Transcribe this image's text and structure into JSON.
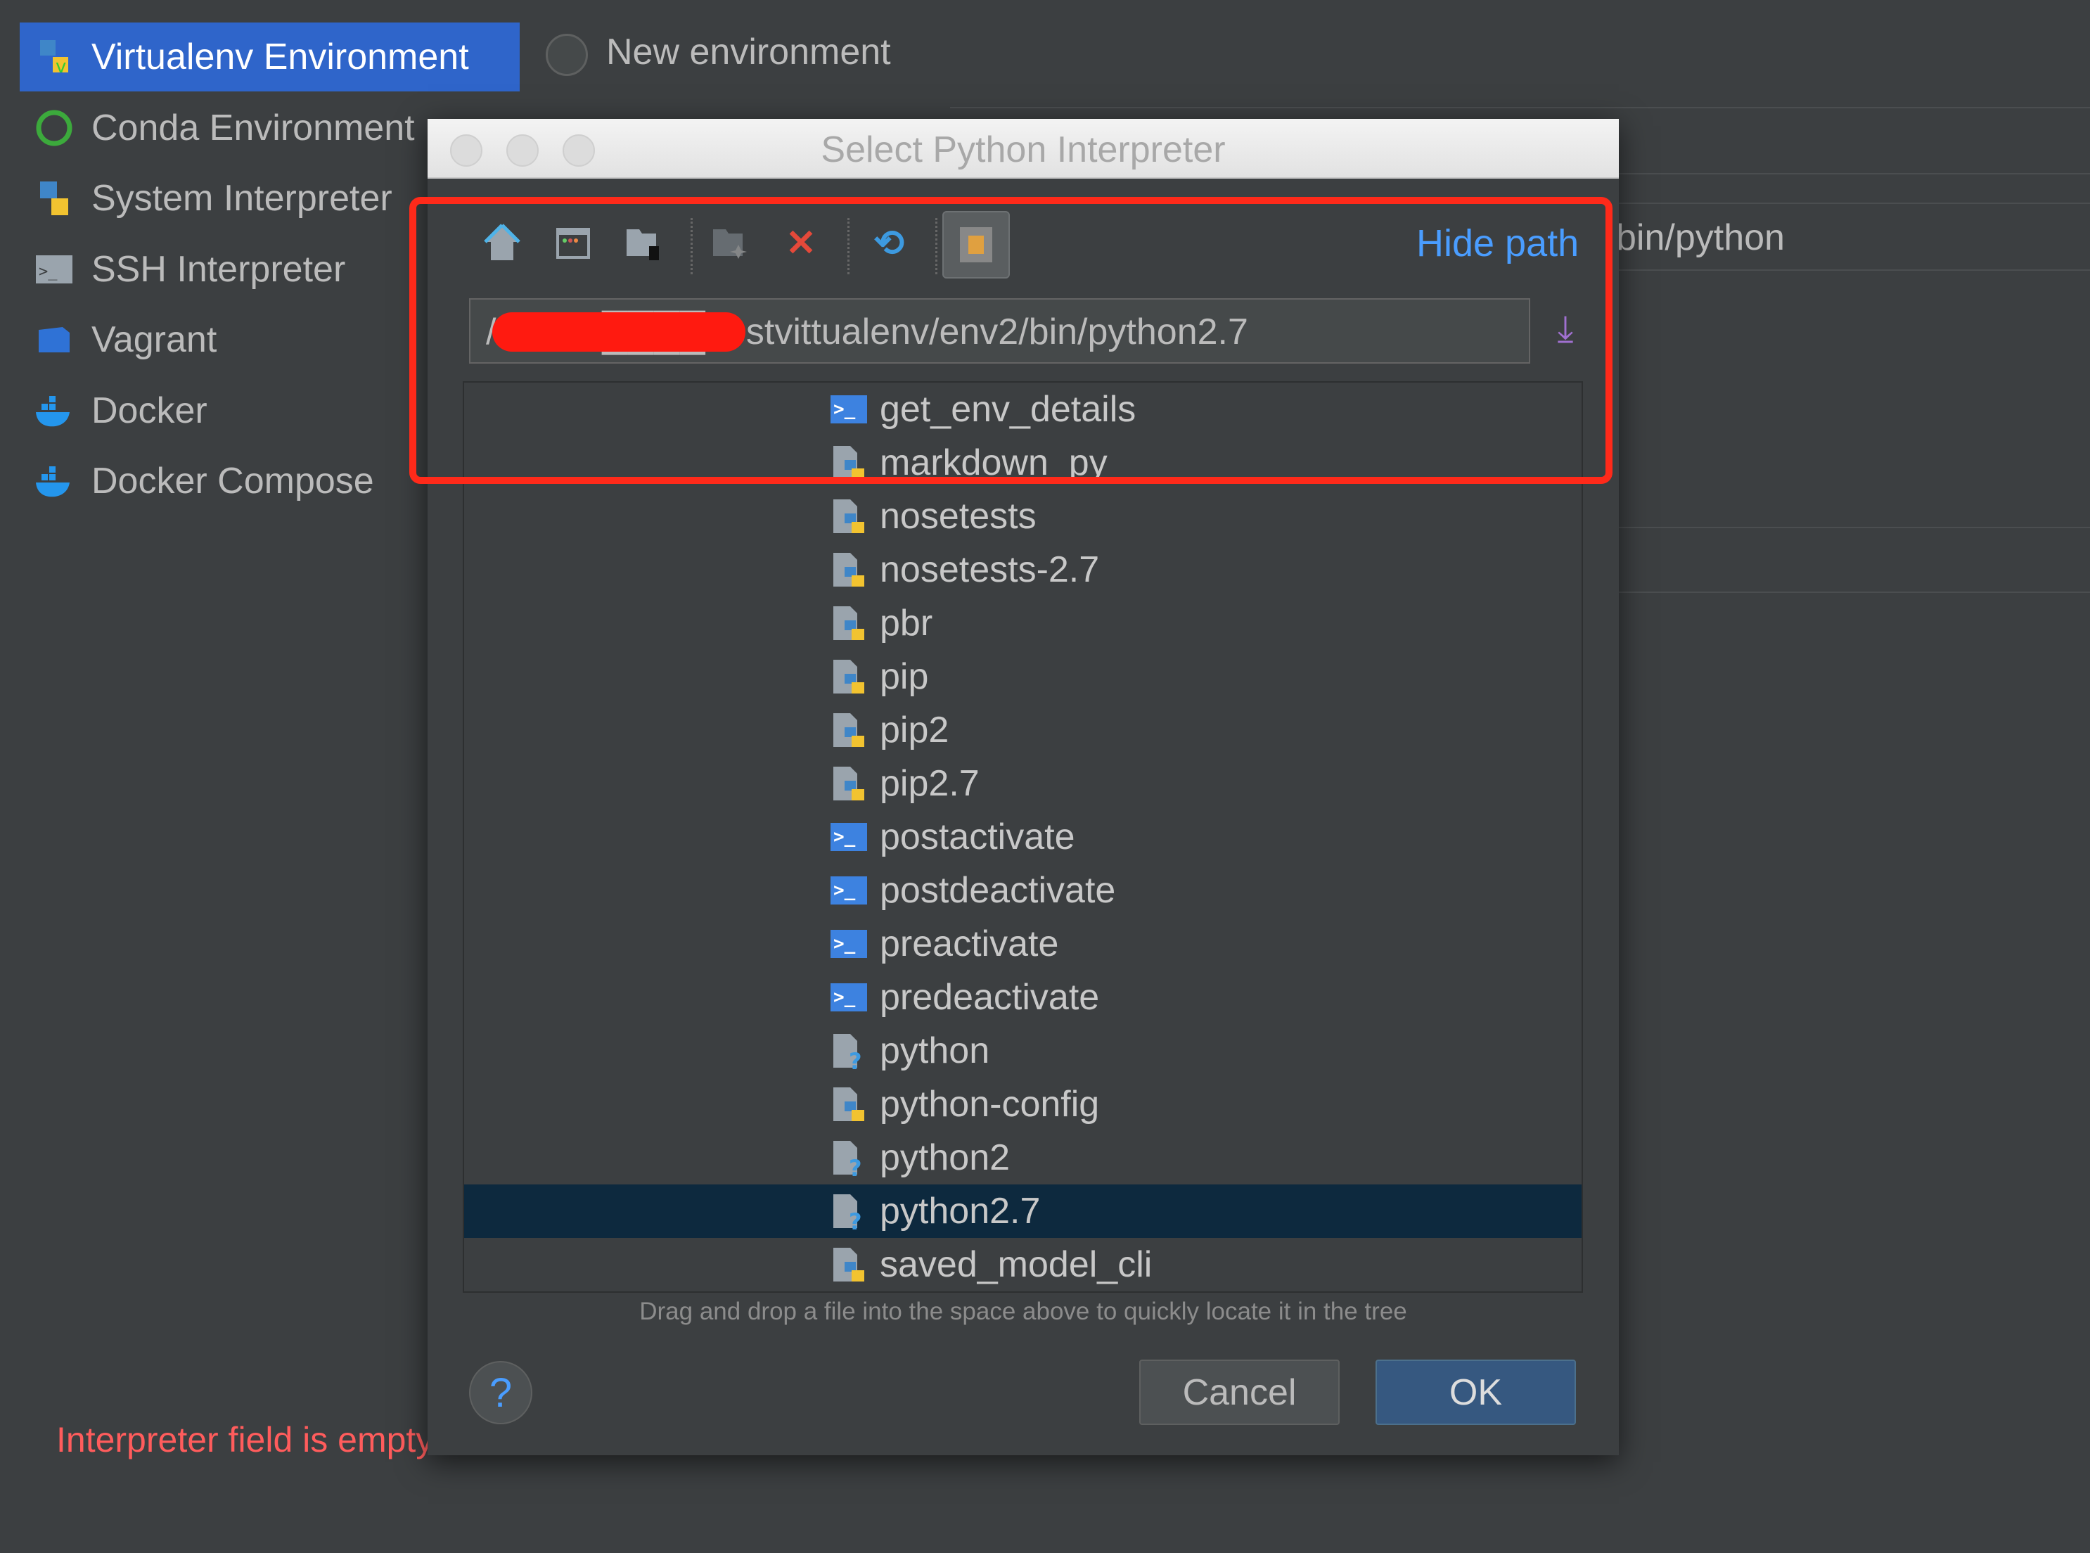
{
  "sidebar": {
    "items": [
      {
        "label": "Virtualenv Environment",
        "icon": "python-virtualenv-icon",
        "selected": true
      },
      {
        "label": "Conda Environment",
        "icon": "conda-icon"
      },
      {
        "label": "System Interpreter",
        "icon": "python-icon"
      },
      {
        "label": "SSH Interpreter",
        "icon": "terminal-icon"
      },
      {
        "label": "Vagrant",
        "icon": "vagrant-icon"
      },
      {
        "label": "Docker",
        "icon": "docker-icon"
      },
      {
        "label": "Docker Compose",
        "icon": "docker-icon"
      }
    ]
  },
  "main": {
    "new_environment": "New environment",
    "interpreter_suffix": "bin/python",
    "error": "Interpreter field is empty"
  },
  "dialog": {
    "title": "Select Python Interpreter",
    "toolbar": {
      "hide_path": "Hide path"
    },
    "path": "/Users/████/testvittualenv/env2/bin/python2.7",
    "files": [
      {
        "name": "get_env_details",
        "type": "shell"
      },
      {
        "name": "markdown_py",
        "type": "python"
      },
      {
        "name": "nosetests",
        "type": "python"
      },
      {
        "name": "nosetests-2.7",
        "type": "python"
      },
      {
        "name": "pbr",
        "type": "python"
      },
      {
        "name": "pip",
        "type": "python"
      },
      {
        "name": "pip2",
        "type": "python"
      },
      {
        "name": "pip2.7",
        "type": "python"
      },
      {
        "name": "postactivate",
        "type": "shell"
      },
      {
        "name": "postdeactivate",
        "type": "shell"
      },
      {
        "name": "preactivate",
        "type": "shell"
      },
      {
        "name": "predeactivate",
        "type": "shell"
      },
      {
        "name": "python",
        "type": "unknown"
      },
      {
        "name": "python-config",
        "type": "python"
      },
      {
        "name": "python2",
        "type": "unknown"
      },
      {
        "name": "python2.7",
        "type": "unknown",
        "selected": true
      },
      {
        "name": "saved_model_cli",
        "type": "python"
      }
    ],
    "hint": "Drag and drop a file into the space above to quickly locate it in the tree",
    "help": "?",
    "cancel": "Cancel",
    "ok": "OK"
  },
  "colors": {
    "accent": "#2f65ca",
    "selection": "#0d293e",
    "link": "#4a9dff",
    "error": "#ff5c5c",
    "annotation": "#ff2a1a"
  }
}
